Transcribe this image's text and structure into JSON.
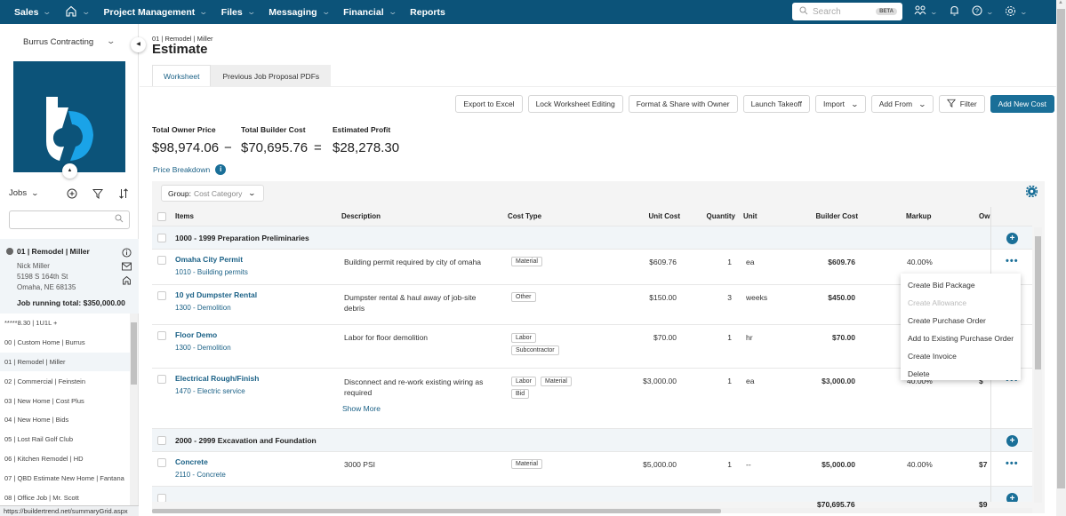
{
  "topnav": {
    "items": [
      {
        "label": "Sales",
        "has_dropdown": true
      },
      {
        "label": "",
        "icon": "home-icon",
        "has_dropdown": true
      },
      {
        "label": "Project Management",
        "has_dropdown": true
      },
      {
        "label": "Files",
        "has_dropdown": true
      },
      {
        "label": "Messaging",
        "has_dropdown": true
      },
      {
        "label": "Financial",
        "has_dropdown": true
      },
      {
        "label": "Reports",
        "has_dropdown": false
      }
    ],
    "search_placeholder": "Search",
    "search_badge": "BETA",
    "icons": [
      "people-icon",
      "bell-icon",
      "help-icon",
      "settings-gear-icon"
    ],
    "chevron": "⌄"
  },
  "sidebar": {
    "company": "Burrus Contracting",
    "jobs_label": "Jobs",
    "jobs_search_placeholder": "",
    "selected_job": {
      "title": "01 | Remodel | Miller",
      "owner": "Nick Miller",
      "address1": "5198 S 164th St",
      "address2": "Omaha, NE 68135",
      "running_total": "Job running total: $350,000.00"
    },
    "jobs": [
      "*****8.30 | 1U1L +",
      "00 | Custom Home | Burrus",
      "01 | Remodel | Miller",
      "02 | Commercial | Feinstein",
      "03 | New Home | Cost Plus",
      "04 | New Home | Bids",
      "05 | Lost Rail Golf Club",
      "06 | Kitchen Remodel | HD",
      "07 | QBD Estimate New Home | Fantana",
      "08 | Office Job | Mr. Scott"
    ],
    "selected_index": 2,
    "status_url": "https://buildertrend.net/summaryGrid.aspx"
  },
  "page": {
    "breadcrumb": "01 | Remodel | Miller",
    "title": "Estimate",
    "tabs": [
      {
        "label": "Worksheet",
        "active": true
      },
      {
        "label": "Previous Job Proposal PDFs",
        "active": false
      }
    ]
  },
  "toolbar": {
    "export": "Export to Excel",
    "lock": "Lock Worksheet Editing",
    "format_share": "Format & Share with Owner",
    "takeoff": "Launch Takeoff",
    "import": "Import",
    "add_from": "Add From",
    "filter": "Filter",
    "add_new": "Add New Cost"
  },
  "totals": {
    "owner_price_label": "Total Owner Price",
    "owner_price": "$98,974.06",
    "minus": "−",
    "builder_cost_label": "Total Builder Cost",
    "builder_cost": "$70,695.76",
    "equals": "=",
    "profit_label": "Estimated Profit",
    "profit": "$28,278.30",
    "price_breakdown": "Price Breakdown"
  },
  "grid": {
    "group_label": "Group:",
    "group_value": "Cost Category",
    "columns": [
      "Items",
      "Description",
      "Cost Type",
      "Unit Cost",
      "Quantity",
      "Unit",
      "Builder Cost",
      "Markup",
      "Ow"
    ],
    "groups": [
      {
        "title": "1000 - 1999 Preparation Preliminaries",
        "items": [
          {
            "name": "Omaha City Permit",
            "code": "1010 - Building permits",
            "description": "Building permit required by city of omaha",
            "cost_types": [
              "Material"
            ],
            "unit_cost": "$609.76",
            "quantity": "1",
            "unit": "ea",
            "builder_cost": "$609.76",
            "markup": "40.00%",
            "owner": ""
          },
          {
            "name": "10 yd Dumpster Rental",
            "code": "1300 - Demolition",
            "description": "Dumpster rental & haul away of job-site debris",
            "cost_types": [
              "Other"
            ],
            "unit_cost": "$150.00",
            "quantity": "3",
            "unit": "weeks",
            "builder_cost": "$450.00",
            "markup": "",
            "owner": ""
          },
          {
            "name": "Floor Demo",
            "code": "1300 - Demolition",
            "description": "Labor for floor demolition",
            "cost_types": [
              "Labor",
              "Subcontractor"
            ],
            "unit_cost": "$70.00",
            "quantity": "1",
            "unit": "hr",
            "builder_cost": "$70.00",
            "markup": "",
            "owner": ""
          },
          {
            "name": "Electrical Rough/Finish",
            "code": "1470 - Electric service",
            "description": "Disconnect and re-work existing wiring as required",
            "cost_types": [
              "Labor",
              "Material",
              "Bid"
            ],
            "unit_cost": "$3,000.00",
            "quantity": "1",
            "unit": "ea",
            "builder_cost": "$3,000.00",
            "markup": "40.00%",
            "owner": "$"
          }
        ]
      },
      {
        "title": "2000 - 2999 Excavation and Foundation",
        "items": [
          {
            "name": "Concrete",
            "code": "2110 - Concrete",
            "description": "3000 PSI",
            "cost_types": [
              "Material"
            ],
            "unit_cost": "$5,000.00",
            "quantity": "1",
            "unit": "--",
            "builder_cost": "$5,000.00",
            "markup": "40.00%",
            "owner": "$7"
          }
        ]
      }
    ],
    "show_more": "Show More",
    "footer_builder_cost": "$70,695.76",
    "footer_owner": "$9"
  },
  "context_menu": {
    "items": [
      {
        "label": "Create Bid Package",
        "disabled": false
      },
      {
        "label": "Create Allowance",
        "disabled": true
      },
      {
        "label": "Create Purchase Order",
        "disabled": false
      },
      {
        "label": "Add to Existing Purchase Order",
        "disabled": false
      },
      {
        "label": "Create Invoice",
        "disabled": false
      },
      {
        "label": "Delete",
        "disabled": false
      }
    ]
  },
  "colors": {
    "brand_navy": "#0c5379",
    "accent_blue": "#1a6f98",
    "link_blue": "#1c6287",
    "logo_cyan": "#1aa3e8"
  }
}
